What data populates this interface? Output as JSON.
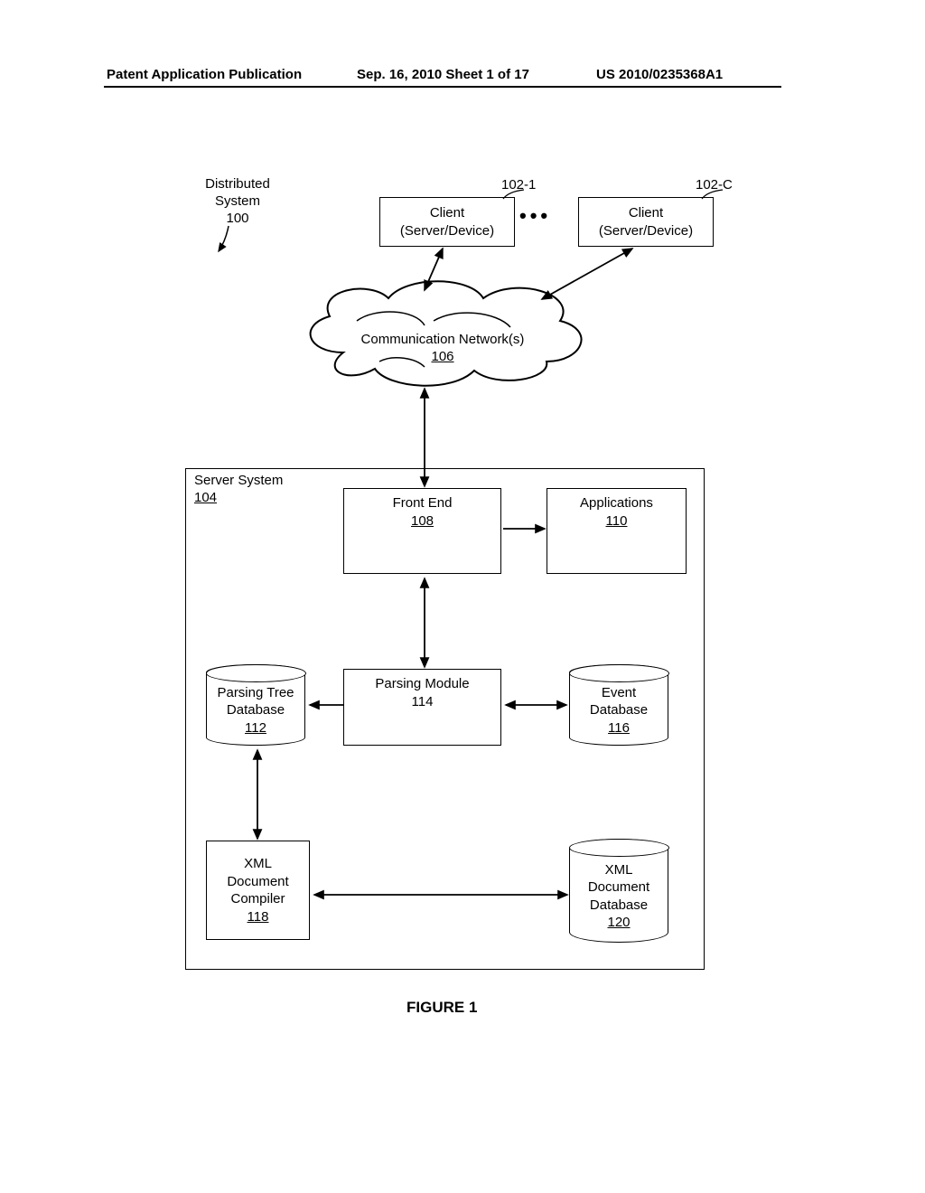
{
  "header": {
    "left": "Patent Application Publication",
    "center": "Sep. 16, 2010  Sheet 1 of 17",
    "right": "US 2010/0235368A1"
  },
  "labels": {
    "distributed_system": "Distributed\nSystem",
    "distributed_system_ref": "100",
    "client1_ref": "102-1",
    "clientC_ref": "102-C",
    "server_system": "Server System",
    "server_system_ref": "104",
    "figure_caption": "FIGURE 1"
  },
  "boxes": {
    "client1_l1": "Client",
    "client1_l2": "(Server/Device)",
    "clientC_l1": "Client",
    "clientC_l2": "(Server/Device)",
    "cloud_l1": "Communication Network(s)",
    "cloud_ref": "106",
    "frontend": "Front End",
    "frontend_ref": "108",
    "applications": "Applications",
    "applications_ref": "110",
    "parsing_module": "Parsing Module",
    "parsing_module_ref": "114",
    "parsing_tree_db_l1": "Parsing Tree",
    "parsing_tree_db_l2": "Database",
    "parsing_tree_db_ref": "112",
    "event_db_l1": "Event",
    "event_db_l2": "Database",
    "event_db_ref": "116",
    "xml_compiler_l1": "XML",
    "xml_compiler_l2": "Document",
    "xml_compiler_l3": "Compiler",
    "xml_compiler_ref": "118",
    "xml_db_l1": "XML",
    "xml_db_l2": "Document",
    "xml_db_l3": "Database",
    "xml_db_ref": "120"
  }
}
